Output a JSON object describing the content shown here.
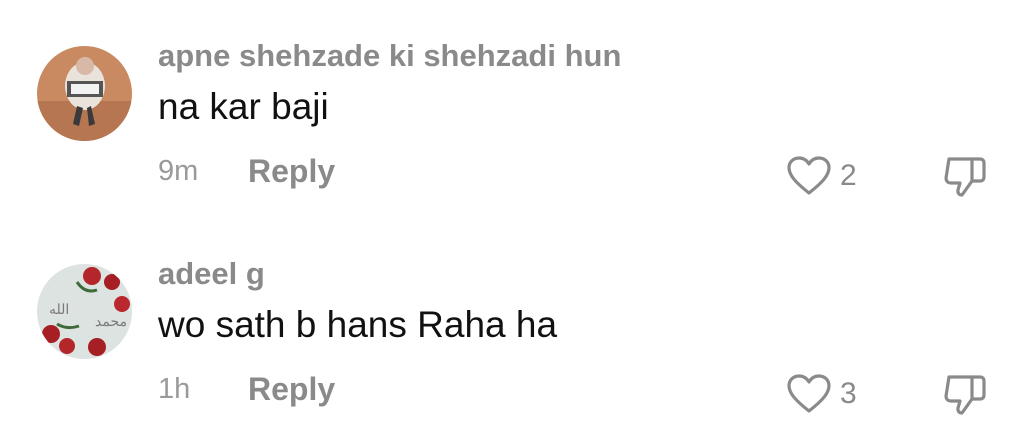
{
  "comments": [
    {
      "username": "apne shehzade ki shehzadi hun",
      "text": "na kar baji",
      "time": "9m",
      "reply_label": "Reply",
      "likes": "2",
      "avatar_icon": "profile-photo"
    },
    {
      "username": "adeel g",
      "text": "wo sath b hans Raha ha",
      "time": "1h",
      "reply_label": "Reply",
      "likes": "3",
      "avatar_icon": "profile-photo-roses"
    }
  ],
  "icons": {
    "like": "heart-outline-icon",
    "dislike": "thumbs-down-outline-icon"
  },
  "colors": {
    "username": "#8a8a8a",
    "text": "#111111",
    "meta": "#9a9a9a",
    "icon": "#8a8a8a"
  }
}
